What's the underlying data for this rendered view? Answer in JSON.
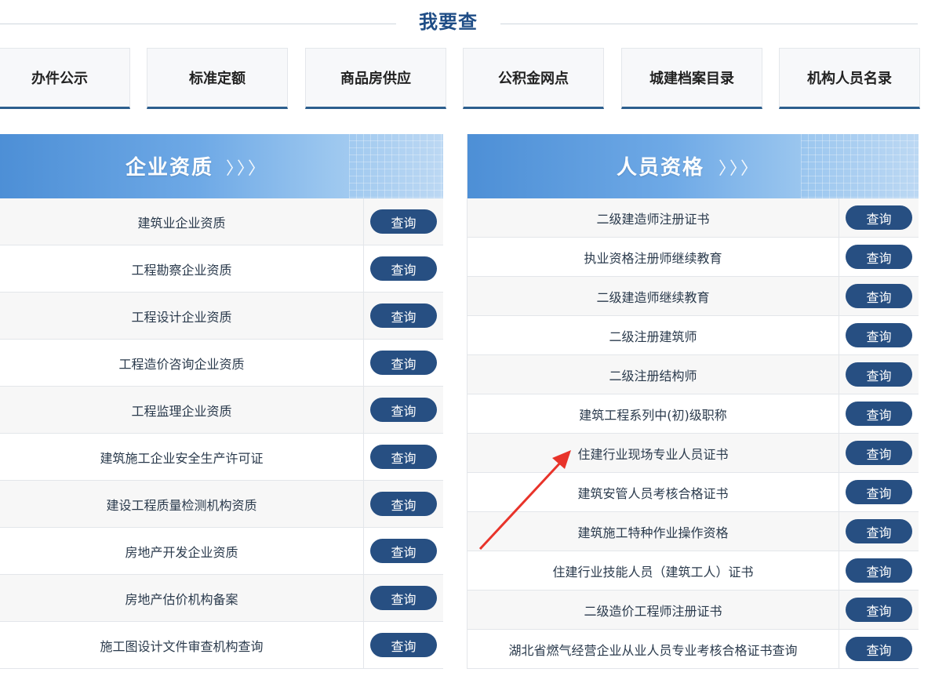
{
  "section": {
    "title": "我要查"
  },
  "quick_links": [
    {
      "label": "办件公示"
    },
    {
      "label": "标准定额"
    },
    {
      "label": "商品房供应"
    },
    {
      "label": "公积金网点"
    },
    {
      "label": "城建档案目录"
    },
    {
      "label": "机构人员名录"
    }
  ],
  "left_panel": {
    "title": "企业资质",
    "arrows": "〉〉〉",
    "button_label": "查询",
    "items": [
      "建筑业企业资质",
      "工程勘察企业资质",
      "工程设计企业资质",
      "工程造价咨询企业资质",
      "工程监理企业资质",
      "建筑施工企业安全生产许可证",
      "建设工程质量检测机构资质",
      "房地产开发企业资质",
      "房地产估价机构备案",
      "施工图设计文件审查机构查询"
    ]
  },
  "right_panel": {
    "title": "人员资格",
    "arrows": "〉〉〉",
    "button_label": "查询",
    "items": [
      "二级建造师注册证书",
      "执业资格注册师继续教育",
      "二级建造师继续教育",
      "二级注册建筑师",
      "二级注册结构师",
      "建筑工程系列中(初)级职称",
      "住建行业现场专业人员证书",
      "建筑安管人员考核合格证书",
      "建筑施工特种作业操作资格",
      "住建行业技能人员（建筑工人）证书",
      "二级造价工程师注册证书",
      "湖北省燃气经营企业从业人员专业考核合格证书查询"
    ]
  },
  "colors": {
    "accent": "#1f4d86",
    "button": "#274f82",
    "annotation": "#e8332a"
  },
  "icons": {
    "annotation": "red-arrow-icon"
  }
}
